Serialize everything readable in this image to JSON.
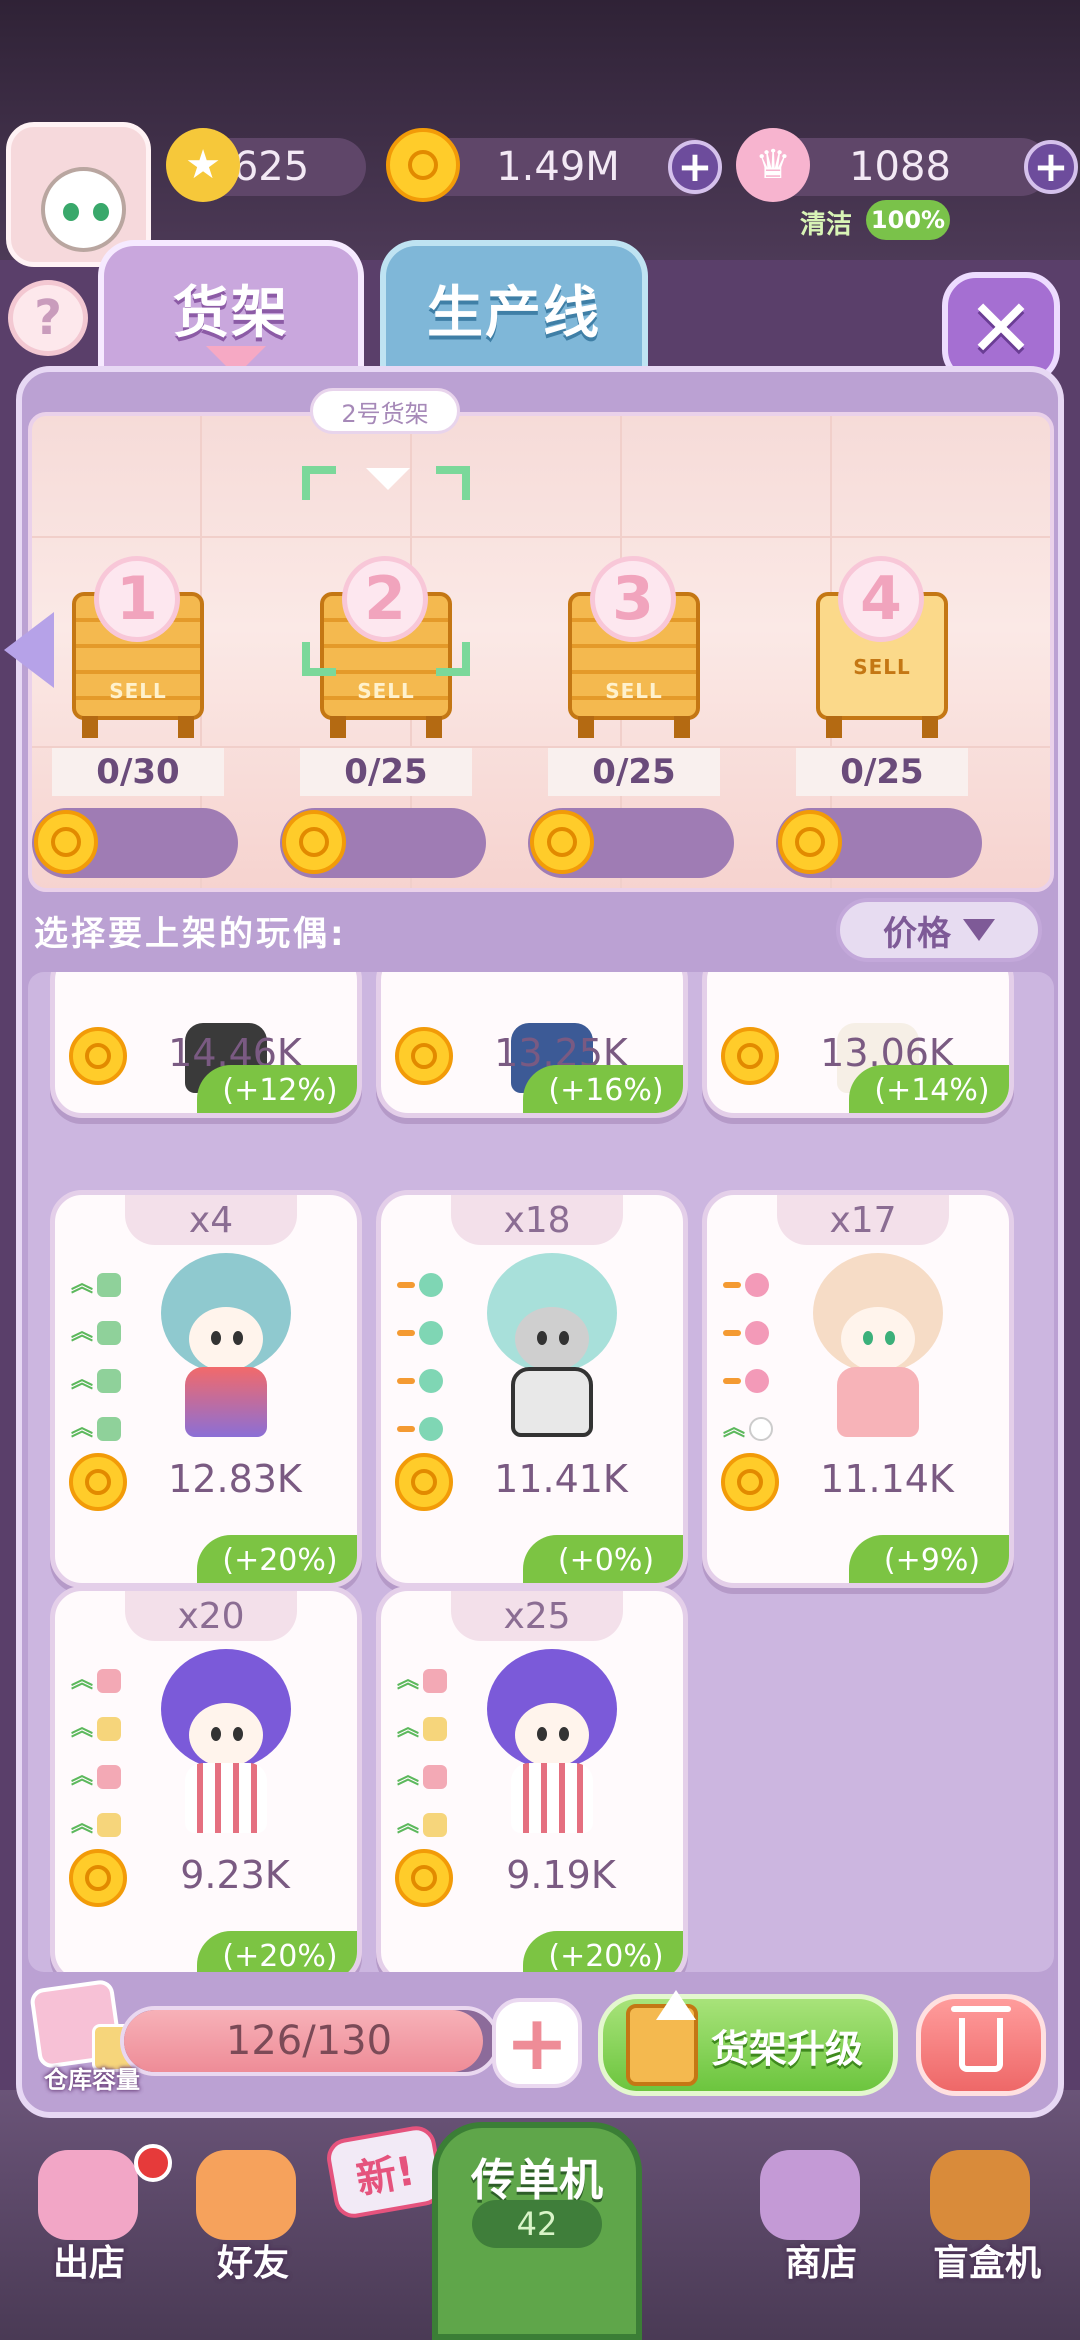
{
  "header": {
    "stars": "625",
    "coins": "1.49M",
    "crowns": "1088",
    "clean_label": "清洁",
    "clean_value": "100%"
  },
  "tabs": [
    {
      "label": "货架"
    },
    {
      "label": "生产线"
    }
  ],
  "shelf_selected_label": "2号货架",
  "shelves": [
    {
      "num": "1",
      "count": "0/30",
      "sell": "SELL"
    },
    {
      "num": "2",
      "count": "0/25",
      "sell": "SELL"
    },
    {
      "num": "3",
      "count": "0/25",
      "sell": "SELL"
    },
    {
      "num": "4",
      "count": "0/25",
      "sell": "SELL"
    }
  ],
  "select_label": "选择要上架的玩偶:",
  "sort_label": "价格",
  "dolls": [
    {
      "qty": "",
      "price": "14.46K",
      "bonus": "(+12%)"
    },
    {
      "qty": "",
      "price": "13.25K",
      "bonus": "(+16%)"
    },
    {
      "qty": "",
      "price": "13.06K",
      "bonus": "(+14%)"
    },
    {
      "qty": "x4",
      "price": "12.83K",
      "bonus": "(+20%)"
    },
    {
      "qty": "x18",
      "price": "11.41K",
      "bonus": "(+0%)"
    },
    {
      "qty": "x17",
      "price": "11.14K",
      "bonus": "(+9%)"
    },
    {
      "qty": "x20",
      "price": "9.23K",
      "bonus": "(+20%)"
    },
    {
      "qty": "x25",
      "price": "9.19K",
      "bonus": "(+20%)"
    }
  ],
  "warehouse": {
    "label": "仓库容量",
    "capacity": "126/130",
    "capacity_fraction": 0.969
  },
  "upgrade_label": "货架升级",
  "nav": {
    "out_store": "出店",
    "friends": "好友",
    "flyer": "传单机",
    "flyer_count": "42",
    "new_badge": "新!",
    "shop": "商店",
    "blind_box": "盲盒机"
  },
  "colors": {
    "panel": "#bba1d3",
    "bonus_green": "#7cc443",
    "coin_gold": "#ffcc2a",
    "upgrade_green": "#6cc53e",
    "trash_red": "#ee6868"
  }
}
